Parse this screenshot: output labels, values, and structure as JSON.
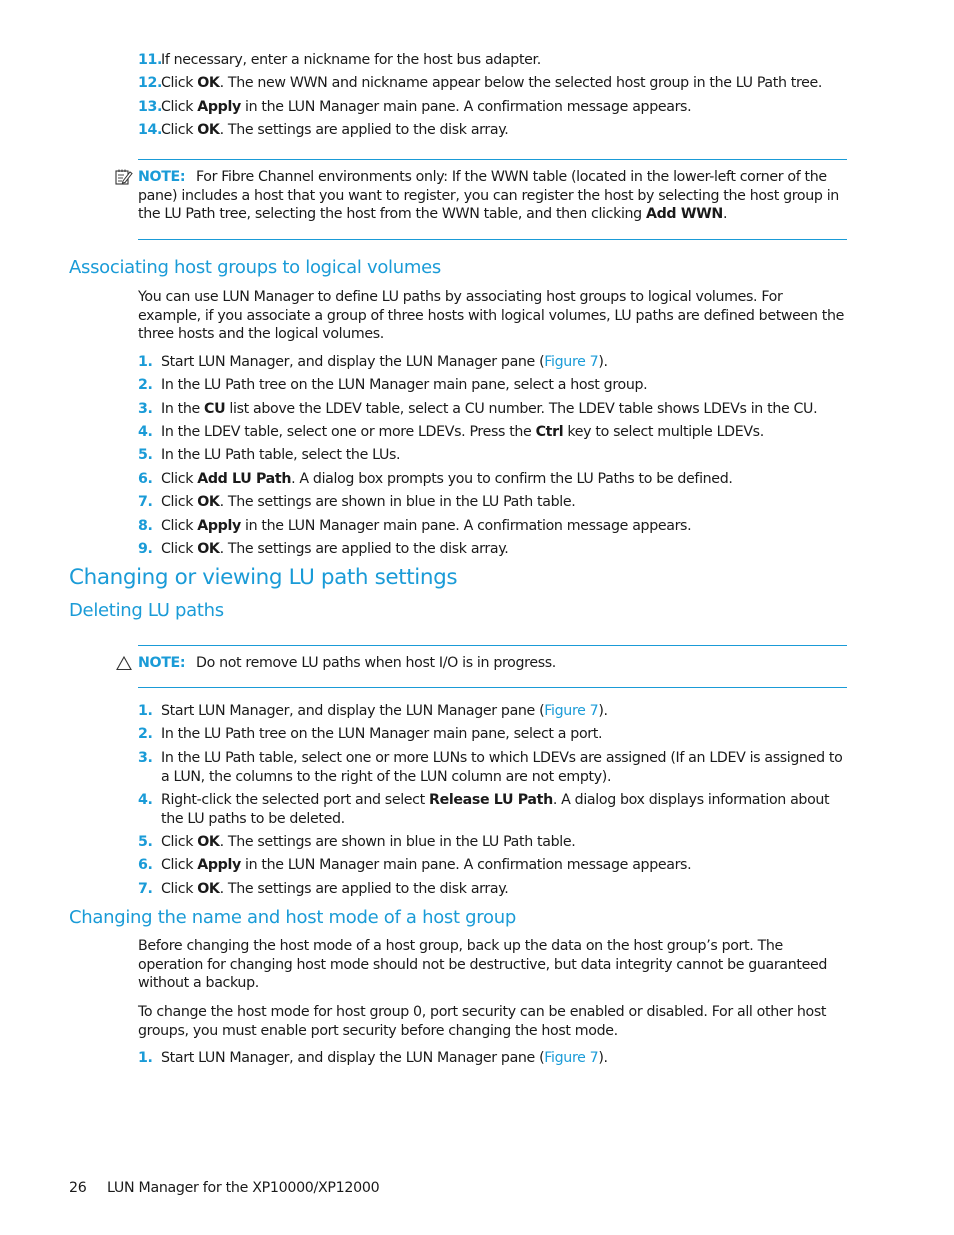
{
  "top_steps": [
    {
      "num": "11.",
      "text": "If necessary, enter a nickname for the host bus adapter."
    },
    {
      "num": "12.",
      "pre": "Click ",
      "bold": "OK",
      "post": ". The new WWN and nickname appear below the selected host group in the LU Path tree."
    },
    {
      "num": "13.",
      "pre": "Click ",
      "bold": "Apply",
      "post": " in the LUN Manager main pane. A confirmation message appears."
    },
    {
      "num": "14.",
      "pre": "Click ",
      "bold": "OK",
      "post": ". The settings are applied to the disk array."
    }
  ],
  "note1": {
    "icon": "note-pad-icon",
    "label": "NOTE:",
    "text_pre": "For Fibre Channel environments only: If the WWN table (located in the lower-left corner of the pane) includes a host that you want to register, you can register the host by selecting the host group in the LU Path tree, selecting the host from the WWN table, and then clicking ",
    "text_bold": "Add WWN",
    "text_post": "."
  },
  "section_associating": {
    "heading": "Associating host groups to logical volumes",
    "intro": "You can use LUN Manager to define LU paths by associating host groups to logical volumes. For example, if you associate a group of three hosts with logical volumes, LU paths are defined between the three hosts and the logical volumes.",
    "steps": [
      {
        "num": "1.",
        "pre": "Start LUN Manager, and display the LUN Manager pane (",
        "link": "Figure 7",
        "post": ")."
      },
      {
        "num": "2.",
        "pre": "In the LU Path tree on the LUN Manager main pane, select a host group."
      },
      {
        "num": "3.",
        "pre": "In the ",
        "bold": "CU",
        "post": " list above the LDEV table, select a CU number. The LDEV table shows LDEVs in the CU."
      },
      {
        "num": "4.",
        "pre": "In the LDEV table, select one or more LDEVs. Press the ",
        "bold": "Ctrl",
        "post": " key to select multiple LDEVs."
      },
      {
        "num": "5.",
        "pre": "In the LU Path table, select the LUs."
      },
      {
        "num": "6.",
        "pre": "Click ",
        "bold": "Add LU Path",
        "post": ". A dialog box prompts you to confirm the LU Paths to be defined."
      },
      {
        "num": "7.",
        "pre": "Click ",
        "bold": "OK",
        "post": ". The settings are shown in blue in the LU Path table."
      },
      {
        "num": "8.",
        "pre": "Click ",
        "bold": "Apply",
        "post": " in the LUN Manager main pane. A confirmation message appears."
      },
      {
        "num": "9.",
        "pre": "Click ",
        "bold": "OK",
        "post": ". The settings are applied to the disk array."
      }
    ]
  },
  "chapter_heading": "Changing or viewing LU path settings",
  "section_deleting": {
    "heading": "Deleting LU paths",
    "note": {
      "icon": "caution-triangle-icon",
      "label": "NOTE:",
      "text": "Do not remove LU paths when host I/O is in progress."
    },
    "steps": [
      {
        "num": "1.",
        "pre": "Start LUN Manager, and display the LUN Manager pane (",
        "link": "Figure 7",
        "post": ")."
      },
      {
        "num": "2.",
        "pre": "In the LU Path tree on the LUN Manager main pane, select a port."
      },
      {
        "num": "3.",
        "pre": "In the LU Path table, select one or more LUNs to which LDEVs are assigned (If an LDEV is assigned to a LUN, the columns to the right of the LUN column are not empty)."
      },
      {
        "num": "4.",
        "pre": "Right-click the selected port and select ",
        "bold": "Release LU Path",
        "post": ". A dialog box displays information about the LU paths to be deleted."
      },
      {
        "num": "5.",
        "pre": "Click ",
        "bold": "OK",
        "post": ". The settings are shown in blue in the LU Path table."
      },
      {
        "num": "6.",
        "pre": "Click ",
        "bold": "Apply",
        "post": " in the LUN Manager main pane. A confirmation message appears."
      },
      {
        "num": "7.",
        "pre": "Click ",
        "bold": "OK",
        "post": ". The settings are applied to the disk array."
      }
    ]
  },
  "section_changing_name": {
    "heading": "Changing the name and host mode of a host group",
    "para1": "Before changing the host mode of a host group, back up the data on the host group’s port. The operation for changing host mode should not be destructive, but data integrity cannot be guaranteed without a backup.",
    "para2": "To change the host mode for host group 0, port security can be enabled or disabled. For all other host groups, you must enable port security before changing the host mode.",
    "steps": [
      {
        "num": "1.",
        "pre": "Start LUN Manager, and display the LUN Manager pane (",
        "link": "Figure 7",
        "post": ")."
      }
    ]
  },
  "footer": {
    "page_number": "26",
    "title": "LUN Manager for the XP10000/XP12000"
  },
  "colors": {
    "accent": "#1a9bd7",
    "text": "#1a1a1a"
  }
}
